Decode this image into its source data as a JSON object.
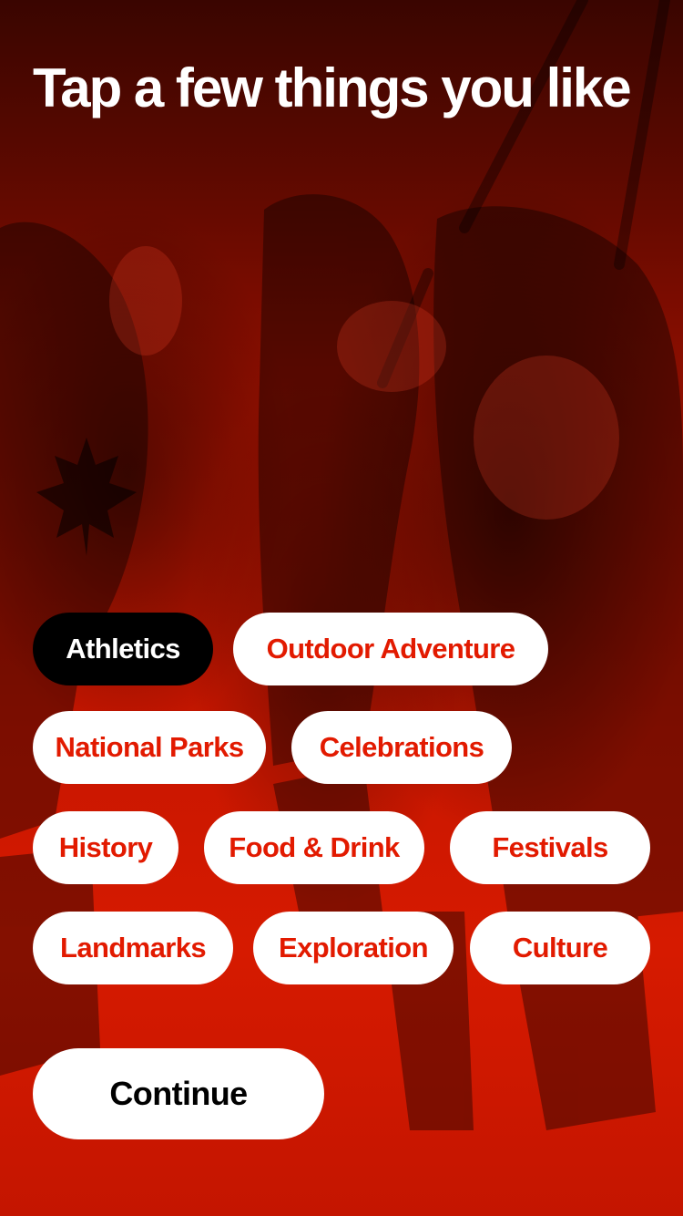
{
  "screen": {
    "title": "Tap a few things you like"
  },
  "background": {
    "description_icon": "hockey-celebration-photo",
    "tint_color": "#d61a00"
  },
  "interests": [
    {
      "label": "Athletics",
      "selected": true
    },
    {
      "label": "Outdoor Adventure",
      "selected": false
    },
    {
      "label": "National Parks",
      "selected": false
    },
    {
      "label": "Celebrations",
      "selected": false
    },
    {
      "label": "History",
      "selected": false
    },
    {
      "label": "Food & Drink",
      "selected": false
    },
    {
      "label": "Festivals",
      "selected": false
    },
    {
      "label": "Landmarks",
      "selected": false
    },
    {
      "label": "Exploration",
      "selected": false
    },
    {
      "label": "Culture",
      "selected": false
    }
  ],
  "actions": {
    "continue_label": "Continue"
  },
  "colors": {
    "accent": "#e21a00",
    "selected_chip": "#000000",
    "chip_background": "#ffffff"
  }
}
